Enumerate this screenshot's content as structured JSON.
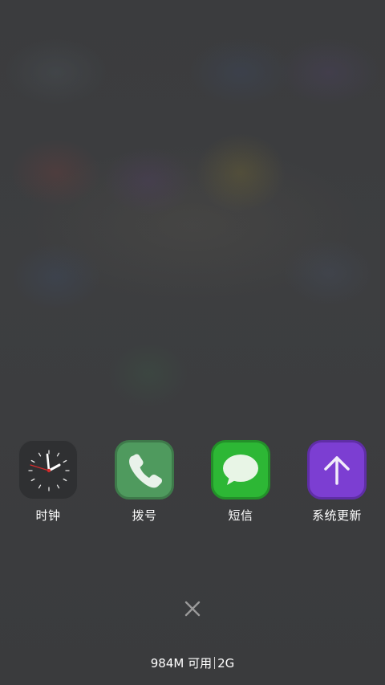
{
  "dock": {
    "apps": [
      {
        "label": "时钟",
        "icon": "clock-icon",
        "color": "#2f3032"
      },
      {
        "label": "拨号",
        "icon": "phone-icon",
        "color": "#4f9a5e"
      },
      {
        "label": "短信",
        "icon": "message-bubble-icon",
        "color": "#2db735"
      },
      {
        "label": "系统更新",
        "icon": "arrow-up-icon",
        "color": "#7c3ed2"
      }
    ]
  },
  "close_button": {
    "icon": "close-icon"
  },
  "status": {
    "memory": "984M 可用",
    "network": "2G"
  }
}
